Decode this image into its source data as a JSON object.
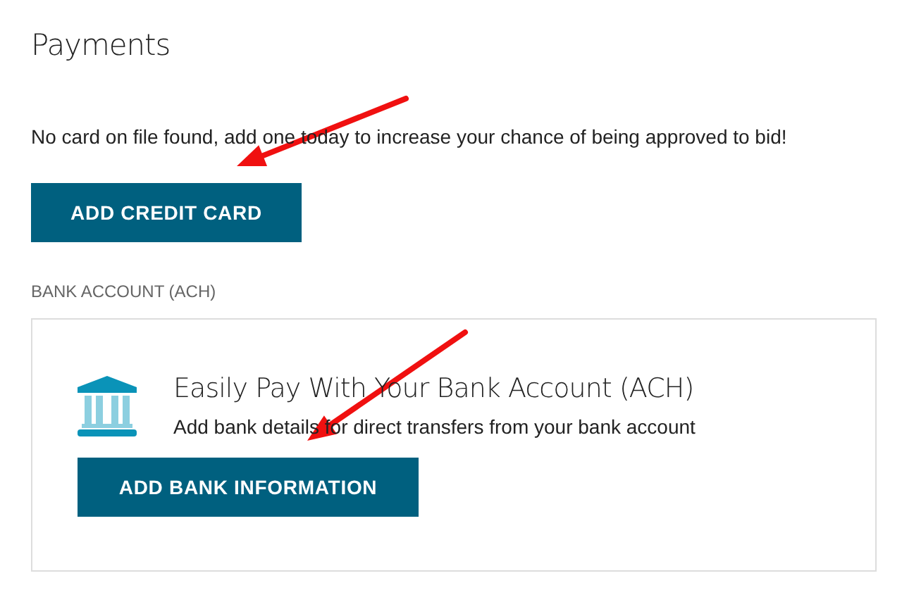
{
  "title": "Payments",
  "notice": "No card on file found, add one today to increase your chance of being approved to bid!",
  "credit_card_button": "ADD CREDIT CARD",
  "bank_section": {
    "label": "BANK ACCOUNT (ACH)",
    "title": "Easily Pay With Your Bank Account (ACH)",
    "description": "Add bank details for direct transfers from your bank account",
    "button": "ADD BANK INFORMATION"
  }
}
